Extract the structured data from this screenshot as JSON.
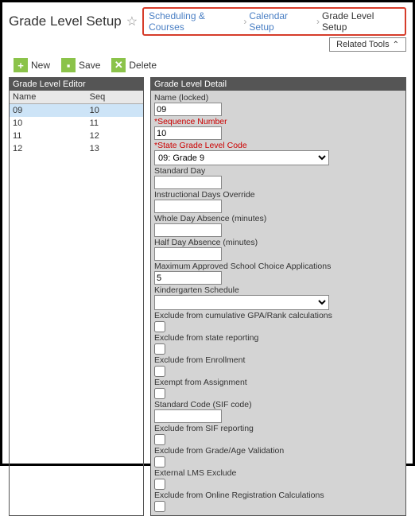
{
  "page_title": "Grade Level Setup",
  "breadcrumb": {
    "items": [
      "Scheduling & Courses",
      "Calendar Setup",
      "Grade Level Setup"
    ]
  },
  "related_tools": "Related Tools",
  "toolbar": {
    "new_label": "New",
    "save_label": "Save",
    "delete_label": "Delete"
  },
  "editor": {
    "title": "Grade Level Editor",
    "columns": [
      "Name",
      "Seq"
    ],
    "rows": [
      {
        "name": "09",
        "seq": "10",
        "selected": true
      },
      {
        "name": "10",
        "seq": "11",
        "selected": false
      },
      {
        "name": "11",
        "seq": "12",
        "selected": false
      },
      {
        "name": "12",
        "seq": "13",
        "selected": false
      }
    ]
  },
  "detail": {
    "title": "Grade Level Detail",
    "fields": {
      "name_label": "Name (locked)",
      "name_value": "09",
      "seq_label": "*Sequence Number",
      "seq_value": "10",
      "state_code_label": "*State Grade Level Code",
      "state_code_value": "09: Grade 9",
      "standard_day_label": "Standard Day",
      "standard_day_value": "",
      "instr_days_label": "Instructional Days Override",
      "instr_days_value": "",
      "whole_day_label": "Whole Day Absence (minutes)",
      "whole_day_value": "",
      "half_day_label": "Half Day Absence (minutes)",
      "half_day_value": "",
      "max_apps_label": "Maximum Approved School Choice Applications",
      "max_apps_value": "5",
      "kinder_label": "Kindergarten Schedule",
      "kinder_value": "",
      "excl_gpa_label": "Exclude from cumulative GPA/Rank calculations",
      "excl_state_label": "Exclude from state reporting",
      "excl_enroll_label": "Exclude from Enrollment",
      "exempt_assign_label": "Exempt from Assignment",
      "sif_code_label": "Standard Code (SIF code)",
      "sif_code_value": "",
      "excl_sif_label": "Exclude from SIF reporting",
      "excl_gradeage_label": "Exclude from Grade/Age Validation",
      "ext_lms_label": "External LMS Exclude",
      "excl_online_label": "Exclude from Online Registration Calculations"
    }
  }
}
